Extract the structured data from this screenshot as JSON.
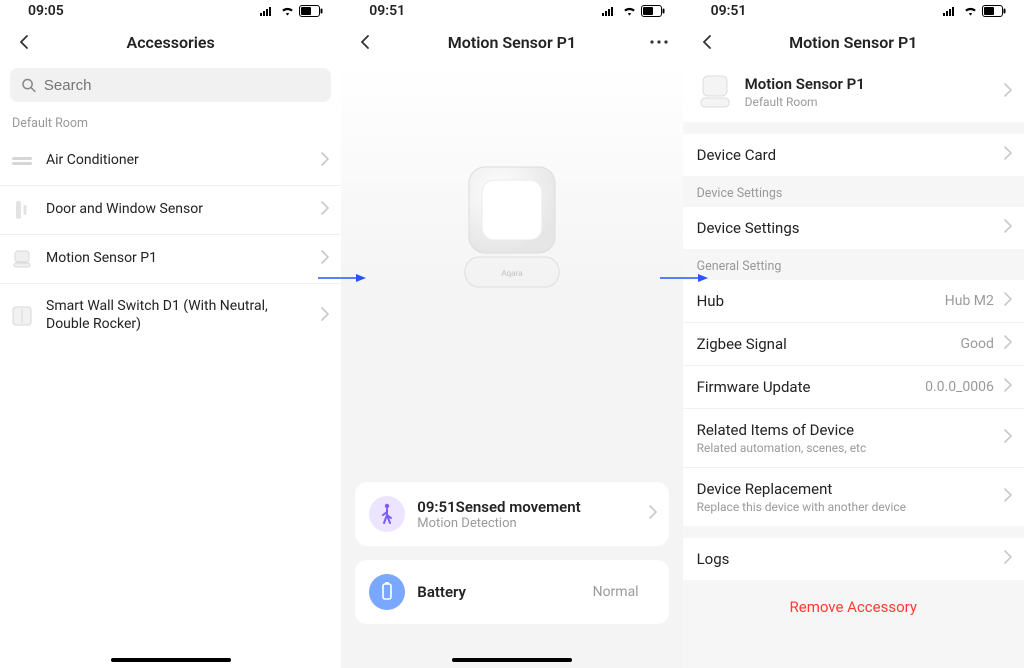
{
  "screen1": {
    "statusbar": {
      "time": "09:05"
    },
    "title": "Accessories",
    "search_placeholder": "Search",
    "section_label": "Default Room",
    "rows": [
      {
        "label": "Air Conditioner"
      },
      {
        "label": "Door and Window Sensor"
      },
      {
        "label": "Motion Sensor P1",
        "highlighted": true
      },
      {
        "label": "Smart Wall Switch D1 (With Neutral, Double Rocker)"
      }
    ]
  },
  "screen2": {
    "statusbar": {
      "time": "09:51"
    },
    "title": "Motion Sensor P1",
    "event": {
      "time_prefix": "09:51",
      "title": "Sensed movement",
      "subtitle": "Motion Detection"
    },
    "battery": {
      "title": "Battery",
      "value": "Normal"
    }
  },
  "screen3": {
    "statusbar": {
      "time": "09:51"
    },
    "title": "Motion Sensor P1",
    "device": {
      "name": "Motion Sensor P1",
      "room": "Default Room"
    },
    "device_card_label": "Device Card",
    "section_device_settings": "Device Settings",
    "device_settings_label": "Device Settings",
    "section_general": "General Setting",
    "hub": {
      "label": "Hub",
      "value": "Hub M2"
    },
    "zigbee": {
      "label": "Zigbee Signal",
      "value": "Good"
    },
    "firmware": {
      "label": "Firmware Update",
      "value": "0.0.0_0006"
    },
    "related": {
      "label": "Related Items of Device",
      "sub": "Related automation, scenes, etc",
      "highlighted": true
    },
    "replacement": {
      "label": "Device Replacement",
      "sub": "Replace this device with another device"
    },
    "logs_label": "Logs",
    "remove_label": "Remove Accessory"
  },
  "colors": {
    "highlight": "#e60000",
    "destructive": "#ff3b30",
    "card_badge_run": "#9b6bff",
    "card_badge_bat": "#7aa7ff"
  }
}
